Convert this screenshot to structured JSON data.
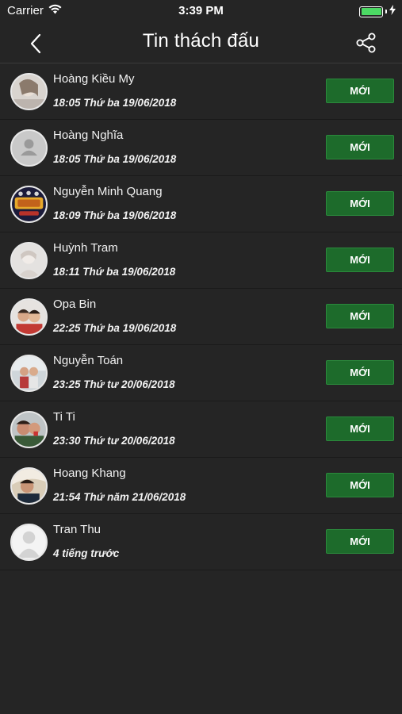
{
  "status_bar": {
    "carrier": "Carrier",
    "time": "3:39 PM"
  },
  "nav": {
    "title": "Tin thách đấu"
  },
  "colors": {
    "background": "#252525",
    "button_green": "#1d6b2b",
    "battery_green": "#4cd964"
  },
  "rows": [
    {
      "name": "Hoàng Kiều My",
      "time": "18:05  Thứ ba 19/06/2018",
      "button": "MỚI",
      "avatar": "photo"
    },
    {
      "name": "Hoàng Nghĩa",
      "time": "18:05  Thứ ba 19/06/2018",
      "button": "MỚI",
      "avatar": "default-user"
    },
    {
      "name": "Nguyễn Minh Quang",
      "time": "18:09  Thứ ba 19/06/2018",
      "button": "MỚI",
      "avatar": "logo"
    },
    {
      "name": "Huỳnh Tram",
      "time": "18:11  Thứ ba 19/06/2018",
      "button": "MỚI",
      "avatar": "photo"
    },
    {
      "name": "Opa Bin",
      "time": "22:25  Thứ ba 19/06/2018",
      "button": "MỚI",
      "avatar": "photo"
    },
    {
      "name": "Nguyễn Toán",
      "time": "23:25  Thứ tư 20/06/2018",
      "button": "MỚI",
      "avatar": "photo"
    },
    {
      "name": "Ti Ti",
      "time": "23:30  Thứ tư 20/06/2018",
      "button": "MỚI",
      "avatar": "photo"
    },
    {
      "name": "Hoang Khang",
      "time": "21:54  Thứ năm 21/06/2018",
      "button": "MỚI",
      "avatar": "photo"
    },
    {
      "name": "Tran Thu",
      "time": "4 tiếng trước",
      "button": "MỚI",
      "avatar": "default-user"
    }
  ]
}
